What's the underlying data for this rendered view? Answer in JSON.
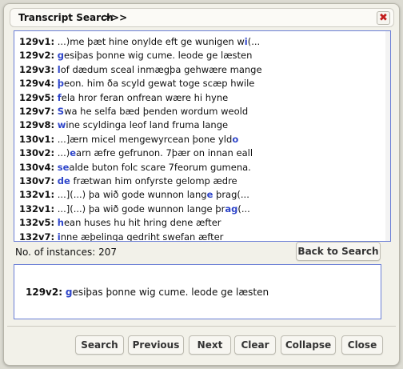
{
  "header": {
    "title": "Transcript Search",
    "arrows": ">>>",
    "close_glyph": "✖"
  },
  "results": [
    {
      "ref": "129v1:",
      "hl": "",
      "pre": " ...)me þæt hine onylde eft ge wunigen w",
      "mark": "i",
      "post": "(..."
    },
    {
      "ref": "129v2:",
      "hl": "g",
      "pre": "",
      "mark": "",
      "post": "esiþas þonne wig cume. leode ge læsten"
    },
    {
      "ref": "129v3:",
      "hl": "l",
      "pre": "",
      "mark": "",
      "post": "of dædum sceal inmægþa gehwære mange"
    },
    {
      "ref": "129v4:",
      "hl": "þ",
      "pre": "",
      "mark": "",
      "post": "eon. him ða scyld gewat toge scæp hwile"
    },
    {
      "ref": "129v5:",
      "hl": "f",
      "pre": "",
      "mark": "",
      "post": "ela hror feran onfrean wære hi hyne"
    },
    {
      "ref": "129v7:",
      "hl": "S",
      "pre": "",
      "mark": "",
      "post": "wa he selfa bæd þenden wordum weold"
    },
    {
      "ref": "129v8:",
      "hl": "w",
      "pre": "",
      "mark": "",
      "post": "ine scyldinga leof land fruma lange"
    },
    {
      "ref": "130v1:",
      "hl": "",
      "pre": " ...]ærn micel mengewyrcean þone yld",
      "mark": "o",
      "post": ""
    },
    {
      "ref": "130v2:",
      "hl": "",
      "pre": " ...)",
      "mark": "e",
      "post": "arn æfre gefrunon. 7þær on innan eall"
    },
    {
      "ref": "130v4:",
      "hl": "se",
      "pre": "",
      "mark": "",
      "post": "alde buton folc scare 7feorum gumena."
    },
    {
      "ref": "130v7:",
      "hl": "de",
      "pre": "",
      "mark": "",
      "post": " frætwan him onfyrste gelomp ædre"
    },
    {
      "ref": "132v1:",
      "hl": "",
      "pre": " ...](...) þa wið gode wunnon lang",
      "mark": "e",
      "post": " þrag(..."
    },
    {
      "ref": "132v1:",
      "hl": "",
      "pre": " ...](...) þa wið gode wunnon lange þr",
      "mark": "ag",
      "post": "(..."
    },
    {
      "ref": "132v5:",
      "hl": "h",
      "pre": "",
      "mark": "",
      "post": "ean huses hu hit hring dene æfter"
    },
    {
      "ref": "132v7:",
      "hl": "i",
      "pre": "",
      "mark": "",
      "post": "nne æþelinga gedriht swefan æfter"
    }
  ],
  "count_label": "No. of instances: 207",
  "back_button": "Back to Search",
  "detail": {
    "ref": "129v2:",
    "hl": "g",
    "rest": "esiþas þonne wig cume. leode ge læsten"
  },
  "buttons": {
    "search": "Search",
    "previous": "Previous",
    "next": "Next",
    "clear": "Clear",
    "collapse": "Collapse",
    "close": "Close"
  },
  "colors": {
    "highlight": "#2e45c9",
    "close_icon": "#c21b1b",
    "box_border": "#6b7fd6"
  }
}
